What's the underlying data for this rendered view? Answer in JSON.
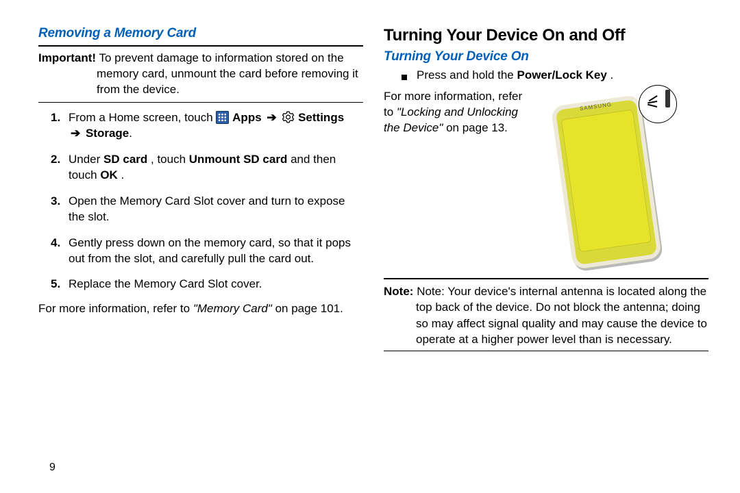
{
  "page_number": "9",
  "left": {
    "heading": "Removing a Memory Card",
    "important_label": "Important!",
    "important_text": "To prevent damage to information stored on the memory card, unmount the card before removing it from the device.",
    "steps": {
      "s1_pre": "From a Home screen, touch ",
      "apps_label": " Apps",
      "arrow": " ➔ ",
      "settings_label": " Settings",
      "s1_post": "Storage",
      "s2_a": "Under ",
      "s2_b": "SD card",
      "s2_c": ", touch ",
      "s2_d": "Unmount SD card",
      "s2_e": " and then touch ",
      "s2_f": "OK",
      "s2_g": ".",
      "s3": "Open the Memory Card Slot cover and turn to expose the slot.",
      "s4": "Gently press down on the memory card, so that it pops out from the slot, and carefully pull the card out.",
      "s5": "Replace the Memory Card Slot cover."
    },
    "ref_pre": "For more information, refer to ",
    "ref_link": "\"Memory Card\"",
    "ref_post": " on page 101."
  },
  "right": {
    "heading": "Turning Your Device On and Off",
    "subheading": "Turning Your Device On",
    "bullet_a": "Press and hold the ",
    "bullet_b": "Power/Lock Key",
    "bullet_c": ".",
    "ref_a": "For more information, refer to ",
    "ref_b": "\"Locking and Unlocking the Device\"",
    "ref_c": " on page 13.",
    "brand": "SAMSUNG",
    "note_label": "Note:",
    "note_text": "Note: Your device's internal antenna is located along the top back of the device. Do not block the antenna; doing so may affect signal quality and may cause the device to operate at a higher power level than is necessary."
  }
}
